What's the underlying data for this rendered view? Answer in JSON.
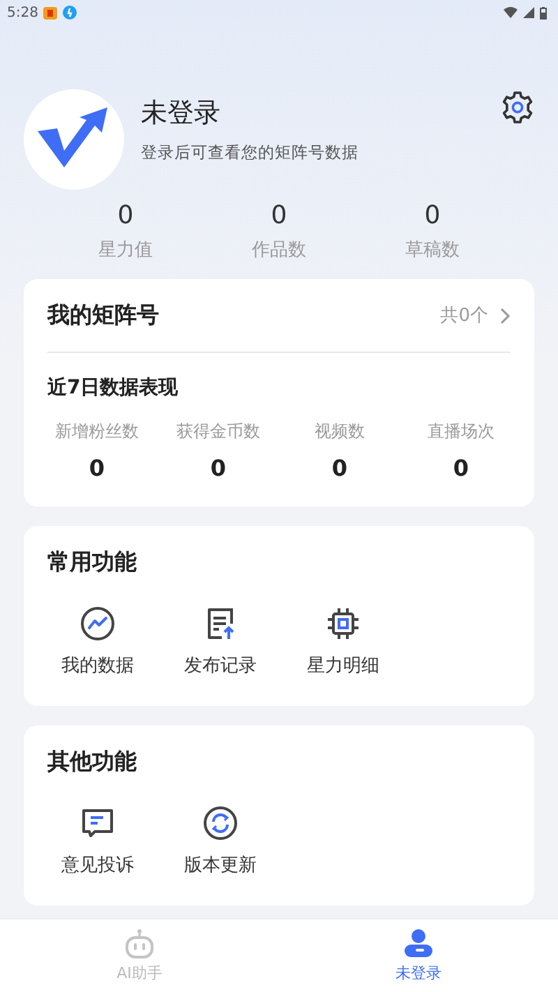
{
  "status_bar": {
    "time": "5:28"
  },
  "profile": {
    "name": "未登录",
    "subtitle": "登录后可查看您的矩阵号数据"
  },
  "stats": [
    {
      "value": "0",
      "label": "星力值"
    },
    {
      "value": "0",
      "label": "作品数"
    },
    {
      "value": "0",
      "label": "草稿数"
    }
  ],
  "matrix_card": {
    "title": "我的矩阵号",
    "count": "共0个",
    "section_title": "近7日数据表现",
    "metrics": [
      {
        "label": "新增粉丝数",
        "value": "0"
      },
      {
        "label": "获得金币数",
        "value": "0"
      },
      {
        "label": "视频数",
        "value": "0"
      },
      {
        "label": "直播场次",
        "value": "0"
      }
    ]
  },
  "common_functions": {
    "title": "常用功能",
    "items": [
      {
        "label": "我的数据",
        "kind": "chart"
      },
      {
        "label": "发布记录",
        "kind": "upload"
      },
      {
        "label": "星力明细",
        "kind": "chip"
      }
    ]
  },
  "other_functions": {
    "title": "其他功能",
    "items": [
      {
        "label": "意见投诉",
        "kind": "feedback"
      },
      {
        "label": "版本更新",
        "kind": "refresh"
      }
    ]
  },
  "tab_bar": [
    {
      "label": "AI助手",
      "kind": "robot",
      "selected": false
    },
    {
      "label": "未登录",
      "kind": "person",
      "selected": true
    }
  ]
}
